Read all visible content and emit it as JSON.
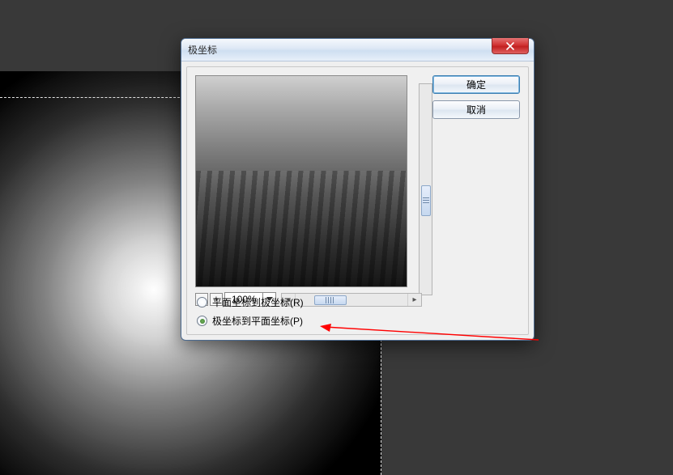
{
  "dialog": {
    "title": "极坐标",
    "buttons": {
      "ok": "确定",
      "cancel": "取消"
    },
    "zoom": {
      "value": "100%",
      "minus": "−",
      "plus": "+"
    },
    "options": {
      "rect_to_polar": "平面坐标到极坐标(R)",
      "polar_to_rect": "极坐标到平面坐标(P)",
      "selected": "polar_to_rect"
    }
  }
}
